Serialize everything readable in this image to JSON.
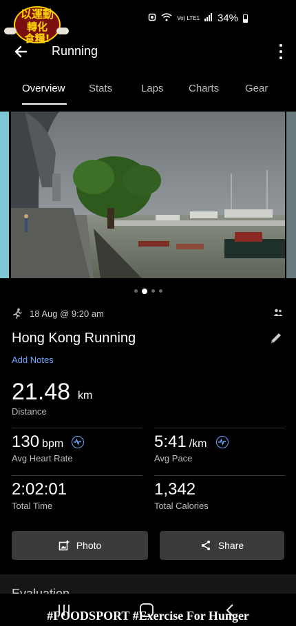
{
  "logo": {
    "line1": "以運動",
    "line2": "轉化",
    "line3": "食糧!"
  },
  "status_bar": {
    "battery_percent": "34%",
    "network_label": "Vo) LTE1"
  },
  "header": {
    "title": "Running"
  },
  "tabs": [
    {
      "label": "Overview",
      "active": true
    },
    {
      "label": "Stats",
      "active": false
    },
    {
      "label": "Laps",
      "active": false
    },
    {
      "label": "Charts",
      "active": false
    },
    {
      "label": "Gear",
      "active": false
    }
  ],
  "photos": {
    "count": 4,
    "current_index": 1
  },
  "activity": {
    "datetime": "18 Aug @ 9:20 am",
    "name": "Hong Kong Running",
    "add_notes_label": "Add Notes"
  },
  "stats": {
    "distance": {
      "value": "21.48",
      "unit": "km",
      "label": "Distance"
    },
    "avg_heart_rate": {
      "value": "130",
      "unit": "bpm",
      "label": "Avg Heart Rate"
    },
    "avg_pace": {
      "value": "5:41",
      "unit": "/km",
      "label": "Avg Pace"
    },
    "total_time": {
      "value": "2:02:01",
      "label": "Total Time"
    },
    "total_calories": {
      "value": "1,342",
      "label": "Total Calories"
    }
  },
  "buttons": {
    "photo": "Photo",
    "share": "Share"
  },
  "section": {
    "evaluation": "Evaluation"
  },
  "watermark": "#FOODSPORT #Exercise For Hunger",
  "colors": {
    "accent": "#6ea7ff",
    "background": "#000000",
    "button": "#3a3a3a"
  }
}
